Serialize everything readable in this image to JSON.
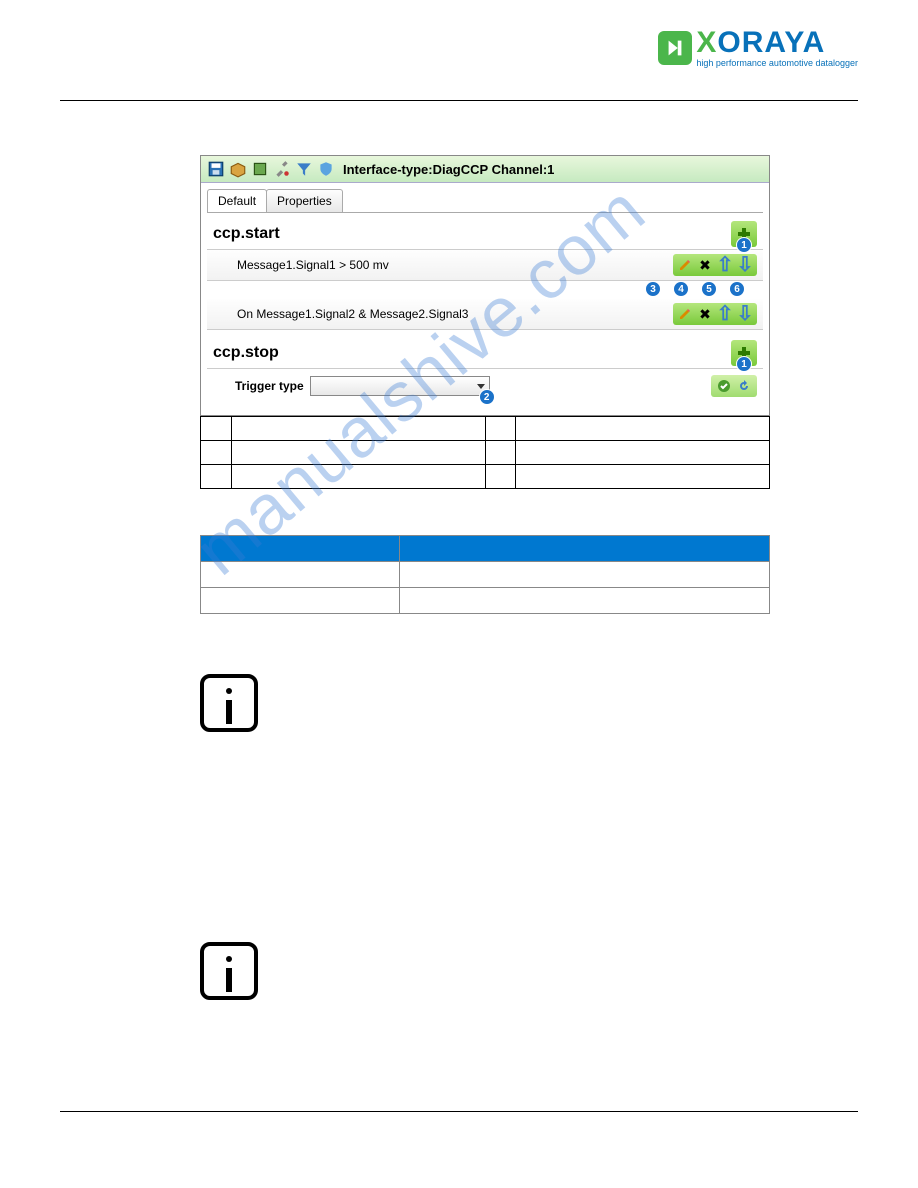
{
  "logo": {
    "name_prefix": "X",
    "name_rest": "ORAYA",
    "tagline": "high performance automotive datalogger"
  },
  "screenshot": {
    "toolbar_title": "Interface-type:DiagCCP Channel:1",
    "tabs": {
      "default": "Default",
      "properties": "Properties"
    },
    "start": {
      "title": "ccp.start",
      "rule1": "Message1.Signal1  >  500 mv",
      "rule2": "On Message1.Signal2 & Message2.Signal3"
    },
    "stop": {
      "title": "ccp.stop",
      "trigger_label": "Trigger type"
    },
    "badges": {
      "b1": "1",
      "b2": "2",
      "b3": "3",
      "b4": "4",
      "b5": "5",
      "b6": "6"
    }
  },
  "watermark": "manualshive.com"
}
